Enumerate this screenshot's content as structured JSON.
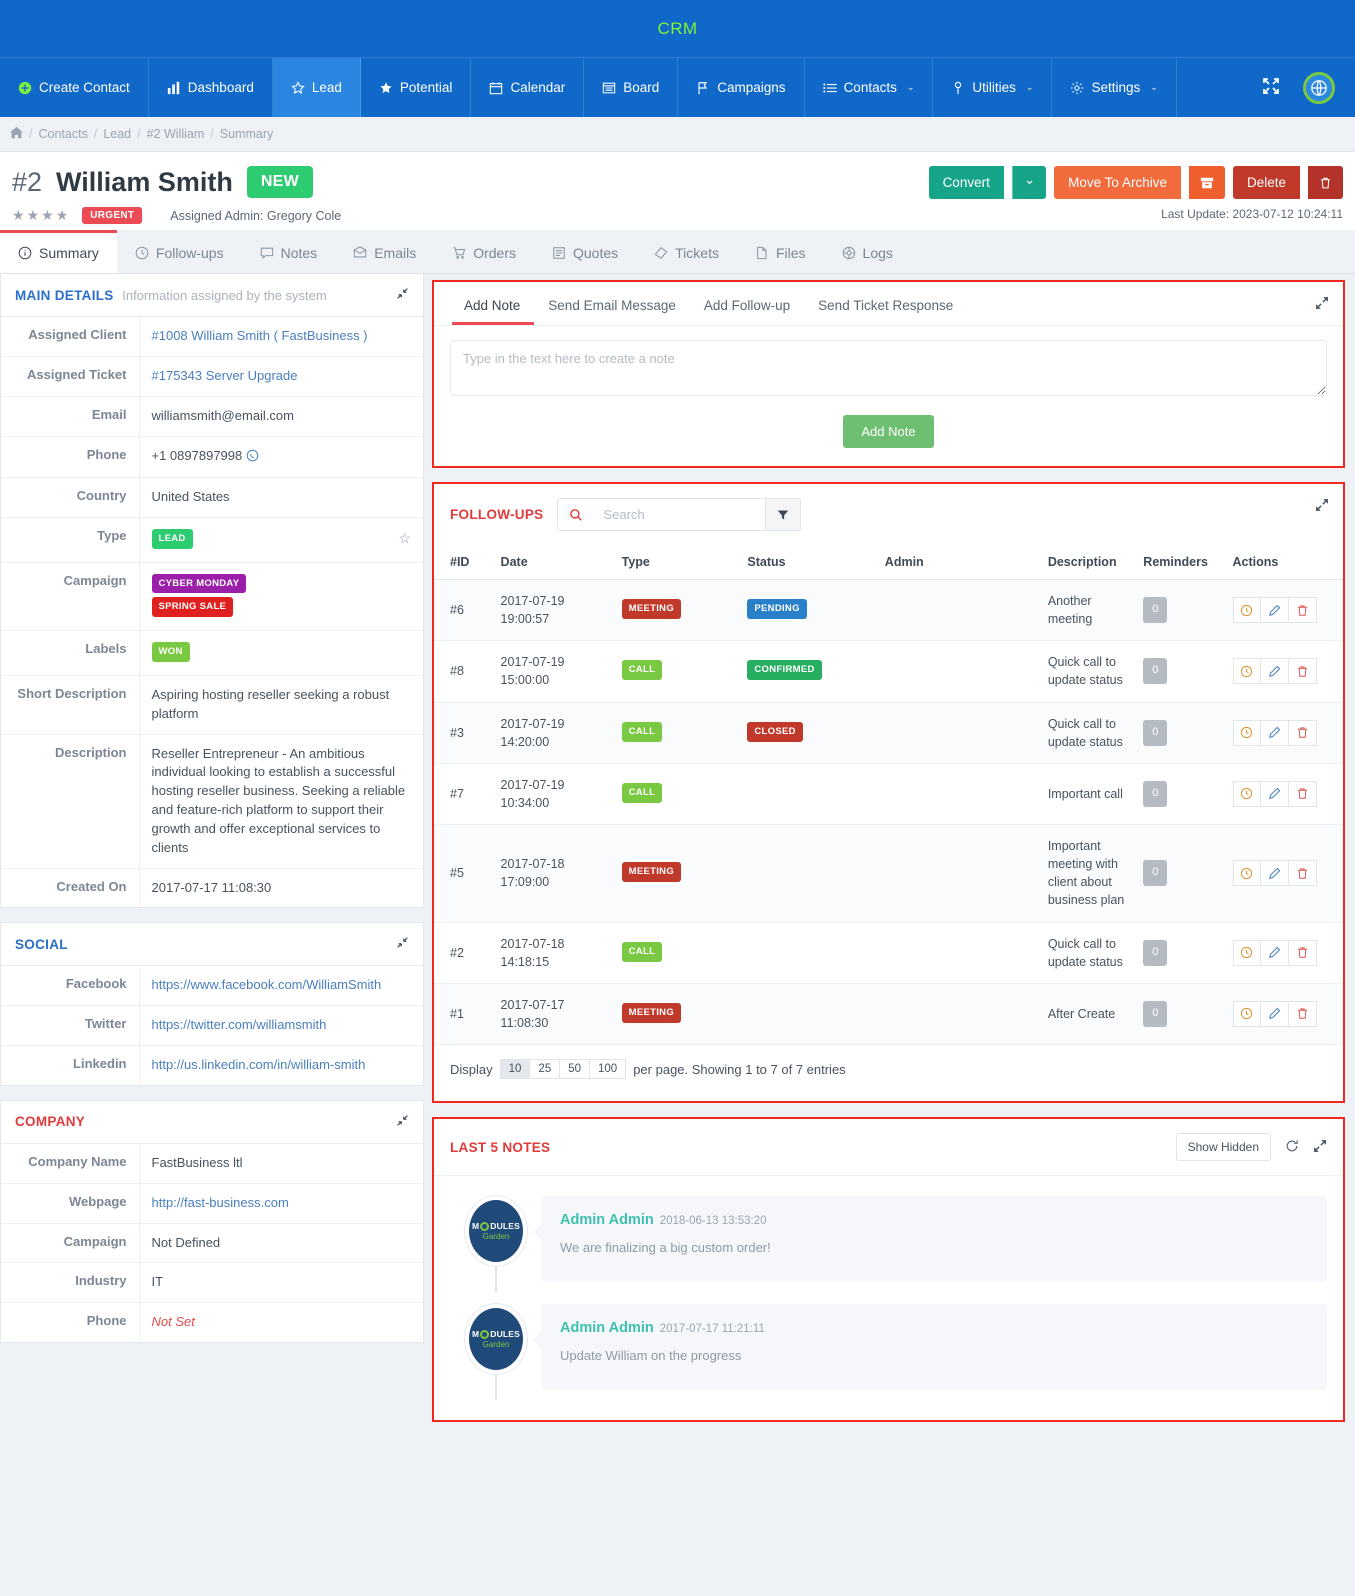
{
  "topbar": {
    "brand": "CRM"
  },
  "nav": {
    "items": [
      {
        "label": "Create Contact",
        "icon": "plus-circle-icon",
        "active": false,
        "caret": false
      },
      {
        "label": "Dashboard",
        "icon": "bar-chart-icon",
        "active": false,
        "caret": false
      },
      {
        "label": "Lead",
        "icon": "star-outline-icon",
        "active": true,
        "caret": false
      },
      {
        "label": "Potential",
        "icon": "star-filled-icon",
        "active": false,
        "caret": false
      },
      {
        "label": "Calendar",
        "icon": "calendar-icon",
        "active": false,
        "caret": false
      },
      {
        "label": "Board",
        "icon": "board-icon",
        "active": false,
        "caret": false
      },
      {
        "label": "Campaigns",
        "icon": "flag-icon",
        "active": false,
        "caret": false
      },
      {
        "label": "Contacts",
        "icon": "list-icon",
        "active": false,
        "caret": true
      },
      {
        "label": "Utilities",
        "icon": "wrench-icon",
        "active": false,
        "caret": true
      },
      {
        "label": "Settings",
        "icon": "gear-icon",
        "active": false,
        "caret": true
      }
    ],
    "caret_glyph": "⌄",
    "fullscreen_icon": "expand-arrows-icon",
    "globe_icon": "globe-icon"
  },
  "breadcrumb": {
    "home_icon": "home-icon",
    "items": [
      "Contacts",
      "Lead",
      "#2 William",
      "Summary"
    ],
    "separator": "/"
  },
  "header": {
    "id": "#2",
    "name": "William Smith",
    "status_badge": "NEW",
    "stars_filled": 4,
    "stars_glyph": "★",
    "priority_badge": "URGENT",
    "assigned_admin": "Assigned Admin: Gregory Cole",
    "convert_label": "Convert",
    "convert_caret": "⌄",
    "archive_label": "Move To Archive",
    "archive_icon": "archive-box-icon",
    "delete_label": "Delete",
    "delete_icon": "trash-icon",
    "last_update": "Last Update: 2023-07-12 10:24:11"
  },
  "tabs": [
    {
      "label": "Summary",
      "icon": "info-circle-icon",
      "active": true
    },
    {
      "label": "Follow-ups",
      "icon": "clock-icon",
      "active": false
    },
    {
      "label": "Notes",
      "icon": "comment-icon",
      "active": false
    },
    {
      "label": "Emails",
      "icon": "envelope-icon",
      "active": false
    },
    {
      "label": "Orders",
      "icon": "cart-icon",
      "active": false
    },
    {
      "label": "Quotes",
      "icon": "document-icon",
      "active": false
    },
    {
      "label": "Tickets",
      "icon": "ticket-icon",
      "active": false
    },
    {
      "label": "Files",
      "icon": "file-icon",
      "active": false
    },
    {
      "label": "Logs",
      "icon": "logs-icon",
      "active": false
    }
  ],
  "main_details": {
    "title": "MAIN DETAILS",
    "subtitle": "Information assigned by the system",
    "collapse_icon": "collapse-icon",
    "rows": [
      {
        "key": "Assigned Client",
        "value": "#1008 William Smith ( FastBusiness )",
        "kind": "link"
      },
      {
        "key": "Assigned Ticket",
        "value": "#175343 Server Upgrade",
        "kind": "link"
      },
      {
        "key": "Email",
        "value": "williamsmith@email.com",
        "kind": "text"
      },
      {
        "key": "Phone",
        "value": "+1 0897897998",
        "kind": "phone",
        "phone_icon": "whatsapp-icon"
      },
      {
        "key": "Country",
        "value": "United States",
        "kind": "text"
      },
      {
        "key": "Type",
        "value": "LEAD",
        "kind": "tag-lead",
        "star_icon": "star-outline-icon"
      },
      {
        "key": "Campaign",
        "value": "",
        "kind": "tags",
        "tags": [
          {
            "label": "CYBER MONDAY",
            "cls": "tag-cyber"
          },
          {
            "label": "SPRING SALE",
            "cls": "tag-spring"
          }
        ]
      },
      {
        "key": "Labels",
        "value": "WON",
        "kind": "tag-won"
      },
      {
        "key": "Short Description",
        "value": "Aspiring hosting reseller seeking a robust platform",
        "kind": "text"
      },
      {
        "key": "Description",
        "value": "Reseller Entrepreneur - An ambitious individual looking to establish a successful hosting reseller business. Seeking a reliable and feature-rich platform to support their growth and offer exceptional services to clients",
        "kind": "text"
      },
      {
        "key": "Created On",
        "value": "2017-07-17 11:08:30",
        "kind": "text"
      }
    ]
  },
  "social": {
    "title": "SOCIAL",
    "collapse_icon": "collapse-icon",
    "rows": [
      {
        "key": "Facebook",
        "value": "https://www.facebook.com/WilliamSmith"
      },
      {
        "key": "Twitter",
        "value": "https://twitter.com/williamsmith"
      },
      {
        "key": "Linkedin",
        "value": "http://us.linkedin.com/in/william-smith"
      }
    ]
  },
  "company": {
    "title": "COMPANY",
    "collapse_icon": "collapse-icon",
    "rows": [
      {
        "key": "Company Name",
        "value": "FastBusiness ltl",
        "kind": "text"
      },
      {
        "key": "Webpage",
        "value": "http://fast-business.com",
        "kind": "link"
      },
      {
        "key": "Campaign",
        "value": "Not Defined",
        "kind": "text"
      },
      {
        "key": "Industry",
        "value": "IT",
        "kind": "text"
      },
      {
        "key": "Phone",
        "value": "Not Set",
        "kind": "notset"
      }
    ]
  },
  "action_box": {
    "tabs": [
      {
        "label": "Add Note",
        "active": true
      },
      {
        "label": "Send Email Message",
        "active": false
      },
      {
        "label": "Add Follow-up",
        "active": false
      },
      {
        "label": "Send Ticket Response",
        "active": false
      }
    ],
    "textarea_placeholder": "Type in the text here to create a note",
    "textarea_value": "",
    "submit_label": "Add Note",
    "expand_icon": "expand-icon"
  },
  "followups": {
    "title": "FOLLOW-UPS",
    "search_icon": "search-icon",
    "search_placeholder": "Search",
    "search_value": "",
    "filter_icon": "filter-icon",
    "expand_icon": "expand-icon",
    "columns": [
      "#ID",
      "Date",
      "Type",
      "Status",
      "Admin",
      "Description",
      "Reminders",
      "Actions"
    ],
    "rows": [
      {
        "id": "#6",
        "date": "2017-07-19 19:00:57",
        "type": "MEETING",
        "type_cls": "tag-meeting",
        "status": "PENDING",
        "status_cls": "tag-pending",
        "admin": "",
        "description": "Another meeting",
        "reminders": "0"
      },
      {
        "id": "#8",
        "date": "2017-07-19 15:00:00",
        "type": "CALL",
        "type_cls": "tag-call",
        "status": "CONFIRMED",
        "status_cls": "tag-confirmed",
        "admin": "",
        "description": "Quick call to update status",
        "reminders": "0"
      },
      {
        "id": "#3",
        "date": "2017-07-19 14:20:00",
        "type": "CALL",
        "type_cls": "tag-call",
        "status": "CLOSED",
        "status_cls": "tag-closed",
        "admin": "",
        "description": "Quick call to update status",
        "reminders": "0"
      },
      {
        "id": "#7",
        "date": "2017-07-19 10:34:00",
        "type": "CALL",
        "type_cls": "tag-call",
        "status": "",
        "status_cls": "",
        "admin": "",
        "description": "Important call",
        "reminders": "0"
      },
      {
        "id": "#5",
        "date": "2017-07-18 17:09:00",
        "type": "MEETING",
        "type_cls": "tag-meeting",
        "status": "",
        "status_cls": "",
        "admin": "",
        "description": "Important meeting with client about business plan",
        "reminders": "0"
      },
      {
        "id": "#2",
        "date": "2017-07-18 14:18:15",
        "type": "CALL",
        "type_cls": "tag-call",
        "status": "",
        "status_cls": "",
        "admin": "",
        "description": "Quick call to update status",
        "reminders": "0"
      },
      {
        "id": "#1",
        "date": "2017-07-17 11:08:30",
        "type": "MEETING",
        "type_cls": "tag-meeting",
        "status": "",
        "status_cls": "",
        "admin": "",
        "description": "After Create",
        "reminders": "0"
      }
    ],
    "action_icons": [
      "clock-icon",
      "pencil-icon",
      "trash-icon"
    ],
    "display_label": "Display",
    "page_sizes": [
      "10",
      "25",
      "50",
      "100"
    ],
    "page_size_active": "10",
    "display_suffix": "per page. Showing 1 to 7 of 7 entries"
  },
  "notes_panel": {
    "title": "LAST 5 NOTES",
    "show_hidden_label": "Show Hidden",
    "refresh_icon": "refresh-icon",
    "expand_icon": "expand-icon",
    "avatar_top": "M",
    "avatar_top_rest": "DULES",
    "avatar_bottom": "Garden",
    "notes": [
      {
        "author": "Admin Admin",
        "time": "2018-06-13 13:53:20",
        "text": "We are finalizing a big custom order!"
      },
      {
        "author": "Admin Admin",
        "time": "2017-07-17 11:21:11",
        "text": "Update William on the progress"
      }
    ]
  }
}
